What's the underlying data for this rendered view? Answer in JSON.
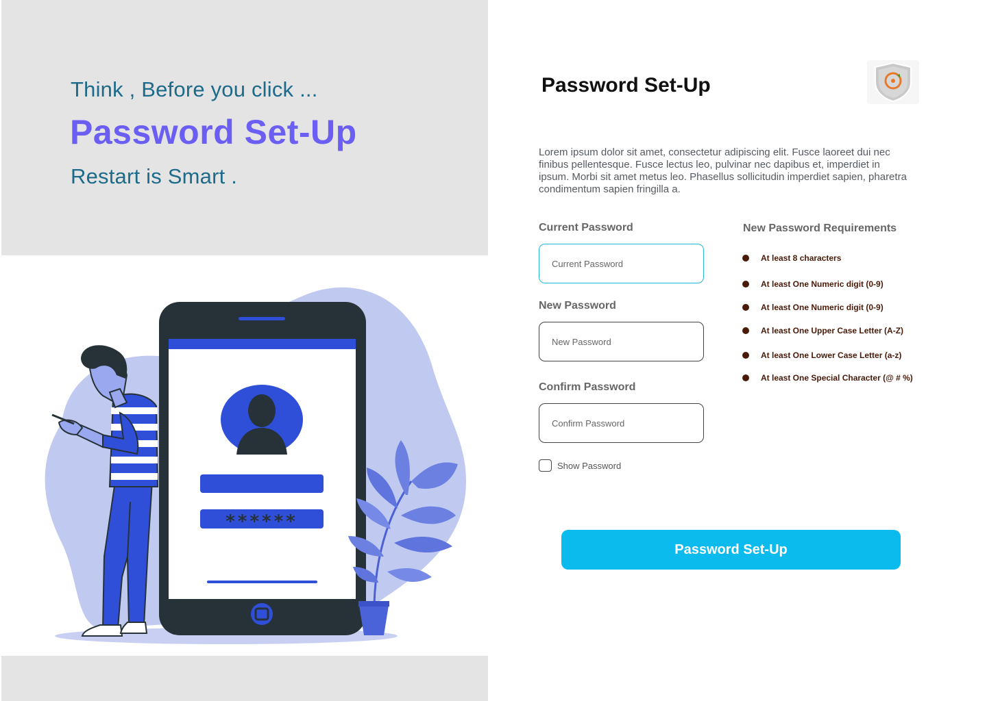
{
  "hero": {
    "tagline": "Think , Before you click ...",
    "title": "Password Set-Up",
    "subline": "Restart is Smart ."
  },
  "form": {
    "title": "Password Set-Up",
    "description": "Lorem ipsum dolor sit amet, consectetur adipiscing elit. Fusce laoreet dui nec finibus pellentesque. Fusce lectus leo, pulvinar nec dapibus et, imperdiet in ipsum. Morbi sit amet metus leo. Phasellus sollicitudin imperdiet sapien, pharetra condimentum sapien fringilla a.",
    "current": {
      "label": "Current Password",
      "placeholder": "Current Password"
    },
    "new": {
      "label": "New Password",
      "placeholder": "New Password"
    },
    "confirm": {
      "label": "Confirm Password",
      "placeholder": "Confirm Password"
    },
    "show_password": "Show Password",
    "submit": "Password Set-Up"
  },
  "requirements": {
    "title": "New Password Requirements",
    "items": [
      "At least 8 characters",
      "At least One Numeric digit (0-9)",
      "At least One Numeric digit (0-9)",
      "At least One Upper Case Letter (A-Z)",
      "At least One Lower Case Letter (a-z)",
      "At least One Special Character (@ # %)"
    ]
  },
  "illustration": {
    "password_mask": "******"
  },
  "icons": {
    "logo": "shield-key-icon",
    "avatar": "user-silhouette-icon",
    "checkbox": "checkbox-icon"
  },
  "colors": {
    "accent": "#6b5ef3",
    "tagline": "#1d6a8a",
    "button": "#0bbbee",
    "focus_border": "#22b8e0",
    "requirement": "#4a1a08",
    "illustration_blue": "#2f4fd8",
    "illustration_blob": "#c0c9f0"
  }
}
